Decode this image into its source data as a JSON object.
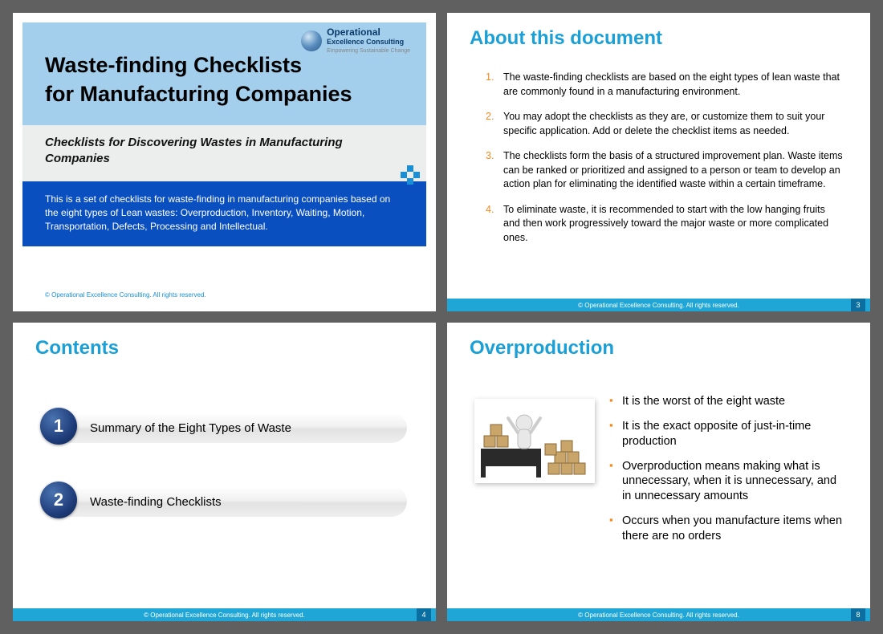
{
  "slide1": {
    "logo_main": "Operational",
    "logo_sub": "Excellence Consulting",
    "logo_tag": "Empowering Sustainable Change",
    "title_line1": "Waste-finding Checklists",
    "title_line2": "for Manufacturing Companies",
    "subtitle": "Checklists for Discovering Wastes in Manufacturing Companies",
    "description": "This is a set of checklists for waste-finding in manufacturing companies based on the eight types of Lean wastes: Overproduction, Inventory, Waiting, Motion, Transportation, Defects, Processing and Intellectual.",
    "copyright": "© Operational Excellence Consulting.  All rights reserved."
  },
  "slide2": {
    "heading": "About this document",
    "items": [
      "The waste-finding checklists are based on the eight types of lean waste that are commonly found in a manufacturing environment.",
      "You may adopt the checklists as they are, or customize them to suit your specific application. Add or delete the checklist items as needed.",
      "The checklists form the basis of a structured improvement plan. Waste items can be ranked or prioritized and assigned to a person or team to develop an action plan for eliminating the identified waste within a certain timeframe.",
      "To eliminate waste, it is recommended to start with the low hanging fruits and then work progressively toward the major waste or more complicated ones."
    ],
    "footer": "© Operational Excellence Consulting.  All rights reserved.",
    "page": "3"
  },
  "slide3": {
    "heading": "Contents",
    "items": [
      {
        "num": "1",
        "label": "Summary of the Eight Types of Waste"
      },
      {
        "num": "2",
        "label": "Waste-finding Checklists"
      }
    ],
    "footer": "© Operational Excellence Consulting.  All rights reserved.",
    "page": "4"
  },
  "slide4": {
    "heading": "Overproduction",
    "items": [
      "It is the worst of the eight waste",
      "It is the exact opposite of just-in-time production",
      "Overproduction means making what is unnecessary, when it is unnecessary, and in unnecessary amounts",
      "Occurs when you manufacture items when there are no orders"
    ],
    "footer": "© Operational Excellence Consulting.  All rights reserved.",
    "page": "8"
  }
}
